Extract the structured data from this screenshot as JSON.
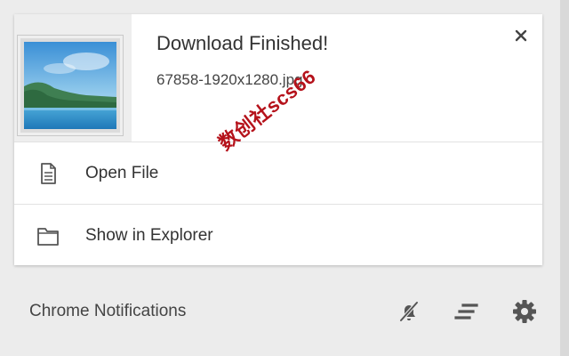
{
  "notification": {
    "title": "Download Finished!",
    "filename": "67858-1920x1280.jpg",
    "close_label": "×",
    "actions": [
      {
        "label": "Open File",
        "icon": "file-icon"
      },
      {
        "label": "Show in Explorer",
        "icon": "folder-icon"
      }
    ]
  },
  "footer": {
    "title": "Chrome Notifications",
    "buttons": [
      {
        "icon": "do-not-disturb-icon"
      },
      {
        "icon": "clear-all-icon"
      },
      {
        "icon": "settings-gear-icon"
      }
    ]
  },
  "watermark": "数创社scs66",
  "colors": {
    "background": "#ececec",
    "card": "#ffffff",
    "text": "#333333",
    "icon": "#555555",
    "watermark": "#b5121b"
  }
}
